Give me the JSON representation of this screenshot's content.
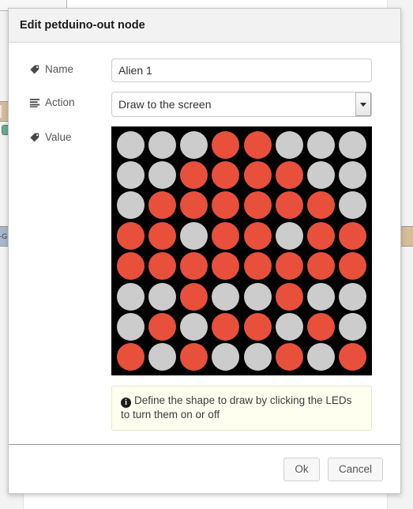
{
  "background": {
    "tab_visible": true,
    "nodes": [
      {
        "name": "node-tan-left",
        "label": ""
      },
      {
        "name": "node-blue-left",
        "label": "-G"
      },
      {
        "name": "node-tan-right",
        "label": ""
      }
    ]
  },
  "dialog": {
    "title": "Edit petduino-out node",
    "fields": {
      "name": {
        "label": "Name",
        "icon": "tag-icon",
        "value": "Alien 1",
        "placeholder": "Name"
      },
      "action": {
        "label": "Action",
        "icon": "list-icon",
        "value": "Draw to the screen",
        "options": [
          "Draw to the screen"
        ]
      },
      "value": {
        "label": "Value",
        "icon": "tag-icon"
      }
    },
    "notice": {
      "icon": "info-icon",
      "text": "Define the shape to draw by clicking the LEDs to turn them on or off"
    },
    "footer": {
      "ok_label": "Ok",
      "cancel_label": "Cancel"
    }
  },
  "led_matrix": {
    "rows": 8,
    "cols": 8,
    "on_color": "#E8503C",
    "off_color": "#CCCCCC",
    "background_color": "#000000",
    "pattern": [
      [
        0,
        0,
        0,
        1,
        1,
        0,
        0,
        0
      ],
      [
        0,
        0,
        1,
        1,
        1,
        1,
        0,
        0
      ],
      [
        0,
        1,
        1,
        1,
        1,
        1,
        1,
        0
      ],
      [
        1,
        1,
        0,
        1,
        1,
        0,
        1,
        1
      ],
      [
        1,
        1,
        1,
        1,
        1,
        1,
        1,
        1
      ],
      [
        0,
        0,
        1,
        0,
        0,
        1,
        0,
        0
      ],
      [
        0,
        1,
        0,
        1,
        1,
        0,
        1,
        0
      ],
      [
        1,
        0,
        1,
        0,
        0,
        1,
        0,
        1
      ]
    ]
  }
}
